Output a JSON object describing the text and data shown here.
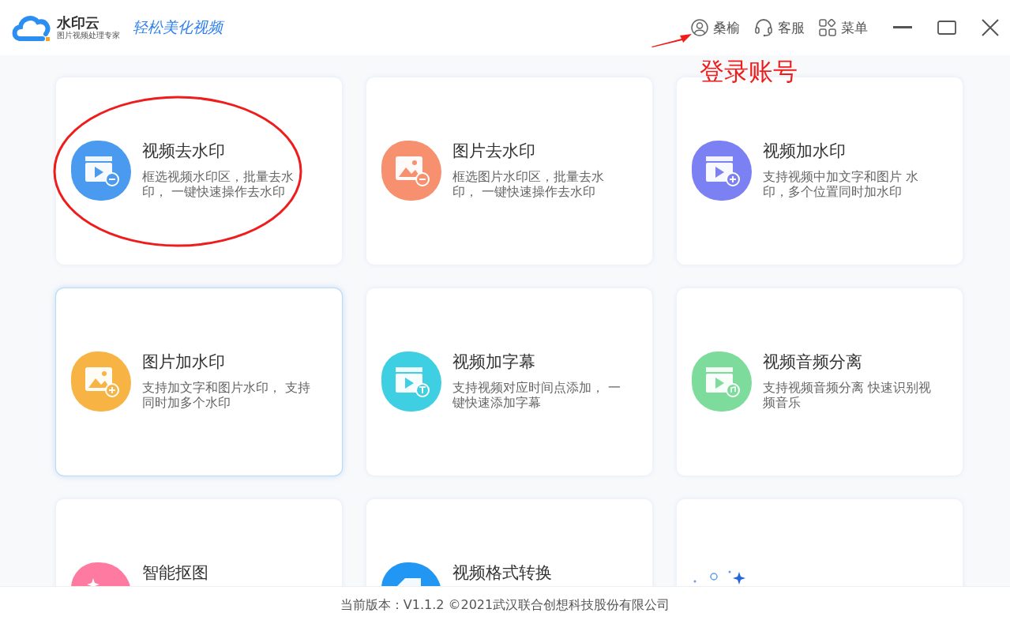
{
  "header": {
    "logo_name": "水印云",
    "logo_tagline": "图片视频处理专家",
    "slogan": "轻松美化视频",
    "user": "桑榆",
    "service": "客服",
    "menu": "菜单"
  },
  "cards": [
    {
      "title": "视频去水印",
      "desc": "框选视频水印区，批量去水印， 一键快速操作去水印",
      "color": "#4a9af0",
      "kind": "video-minus",
      "selected": false
    },
    {
      "title": "图片去水印",
      "desc": "框选图片水印区，批量去水印， 一键快速操作去水印",
      "color": "#f6906f",
      "kind": "image-minus",
      "selected": false
    },
    {
      "title": "视频加水印",
      "desc": "支持视频中加文字和图片 水印，多个位置同时加水印",
      "color": "#7b80f2",
      "kind": "video-plus",
      "selected": false
    },
    {
      "title": "图片加水印",
      "desc": "支持加文字和图片水印， 支持同时加多个水印",
      "color": "#f7b444",
      "kind": "image-plus",
      "selected": true
    },
    {
      "title": "视频加字幕",
      "desc": "支持视频对应时间点添加， 一键快速添加字幕",
      "color": "#3ed0e2",
      "kind": "video-text",
      "selected": false
    },
    {
      "title": "视频音频分离",
      "desc": "支持视频音频分离 快速识别视频音乐",
      "color": "#7ddc9c",
      "kind": "video-music",
      "selected": false
    },
    {
      "title": "智能抠图",
      "color": "#ff7aa0",
      "kind": "cutout",
      "selected": false
    },
    {
      "title": "视频格式转换",
      "color": "#2196f3",
      "kind": "convert",
      "selected": false
    },
    {
      "kind": "promo",
      "selected": false
    }
  ],
  "annotation": {
    "label": "登录账号"
  },
  "footer": "当前版本：V1.1.2 ©2021武汉联合创想科技股份有限公司"
}
